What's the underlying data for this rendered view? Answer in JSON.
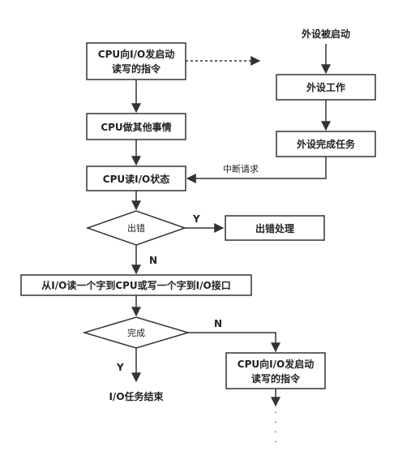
{
  "nodes": {
    "cpu_cmd_line1": "CPU向I/O发启动",
    "cpu_cmd_line2": "读写的指令",
    "cpu_other": "CPU做其他事情",
    "cpu_read_status": "CPU读I/O状态",
    "decision_error": "出错",
    "error_handling": "出错处理",
    "transfer_word": "从I/O读一个字到CPU或写一个字到I/O接口",
    "decision_done": "完成",
    "io_end": "I/O任务结束",
    "cpu_cmd2_line1": "CPU向I/O发启动",
    "cpu_cmd2_line2": "读写的指令",
    "device_started": "外设被启动",
    "device_working": "外设工作",
    "device_done": "外设完成任务"
  },
  "edge_labels": {
    "interrupt_request": "中断请求",
    "error_yes": "Y",
    "error_no": "N",
    "done_no": "N",
    "done_yes": "Y"
  },
  "continuation": "·  ·  ·  ·"
}
